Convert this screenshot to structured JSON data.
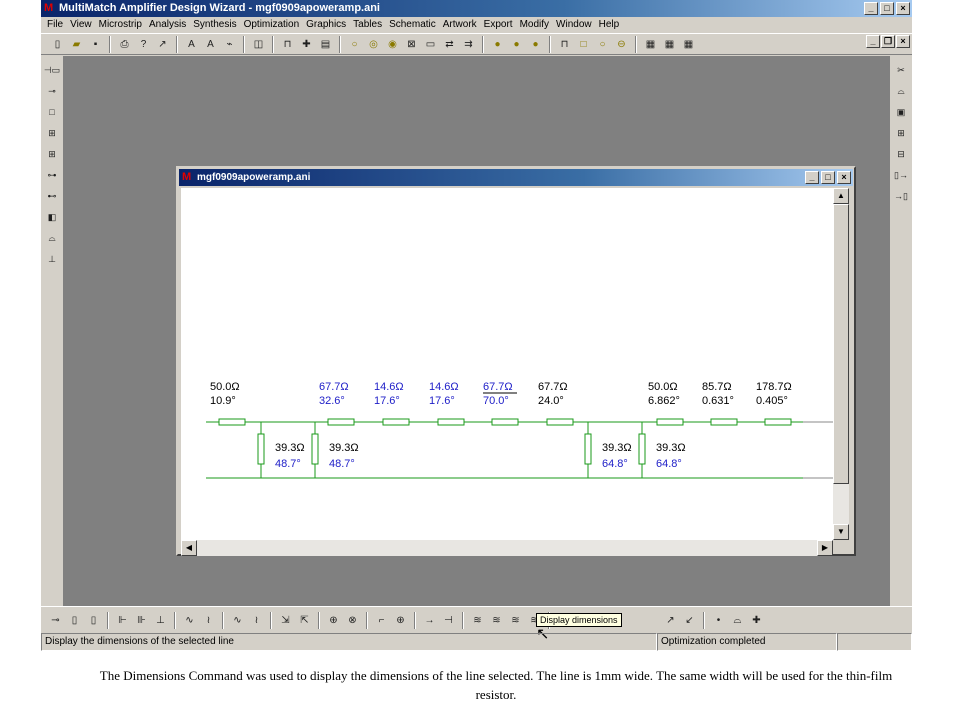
{
  "app": {
    "title": "MultiMatch Amplifier Design Wizard - mgf0909apoweramp.ani",
    "icon": "multimatch-logo-icon"
  },
  "menubar": [
    "File",
    "View",
    "Microstrip",
    "Analysis",
    "Synthesis",
    "Optimization",
    "Graphics",
    "Tables",
    "Schematic",
    "Artwork",
    "Export",
    "Modify",
    "Window",
    "Help"
  ],
  "child_window": {
    "title": "mgf0909apoweramp.ani"
  },
  "schematic": {
    "series": [
      {
        "impedance": "50.0Ω",
        "angle": "10.9°",
        "highlight": false
      },
      {
        "impedance": "67.7Ω",
        "angle": "32.6°",
        "highlight": true
      },
      {
        "impedance": "14.6Ω",
        "angle": "17.6°",
        "highlight": true
      },
      {
        "impedance": "14.6Ω",
        "angle": "17.6°",
        "highlight": true
      },
      {
        "impedance": "67.7Ω",
        "angle": "70.0°",
        "highlight": true,
        "underline": true
      },
      {
        "impedance": "67.7Ω",
        "angle": "24.0°",
        "highlight": false
      },
      {
        "impedance": "50.0Ω",
        "angle": "6.862°",
        "highlight": false
      },
      {
        "impedance": "85.7Ω",
        "angle": "0.631°",
        "highlight": false
      },
      {
        "impedance": "178.7Ω",
        "angle": "0.405°",
        "highlight": false
      }
    ],
    "shunt": [
      {
        "impedance": "39.3Ω",
        "angle": "48.7°"
      },
      {
        "impedance": "39.3Ω",
        "angle": "48.7°"
      },
      {
        "impedance": "39.3Ω",
        "angle": "64.8°"
      },
      {
        "impedance": "39.3Ω",
        "angle": "64.8°"
      }
    ],
    "colors": {
      "line": "#1a9a1a",
      "highlight_text": "#2020c8",
      "text": "#000000"
    }
  },
  "tooltip": "Display dimensions",
  "statusbar": {
    "left": "Display the dimensions of the selected line",
    "right": "Optimization completed"
  },
  "caption": "The Dimensions Command was used to display the dimensions of the line selected. The line is 1mm wide. The same width will be used for the thin-film resistor."
}
